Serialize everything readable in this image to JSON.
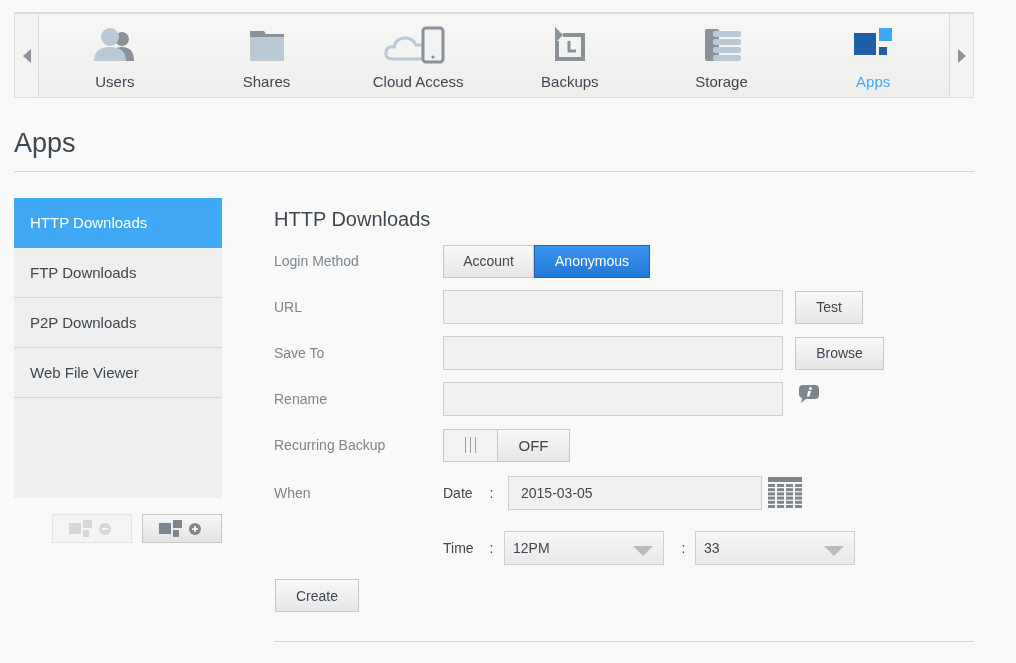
{
  "nav": {
    "items": [
      {
        "label": "Users",
        "selected": false
      },
      {
        "label": "Shares",
        "selected": false
      },
      {
        "label": "Cloud Access",
        "selected": false
      },
      {
        "label": "Backups",
        "selected": false
      },
      {
        "label": "Storage",
        "selected": false
      },
      {
        "label": "Apps",
        "selected": true
      }
    ]
  },
  "page_title": "Apps",
  "sidebar": {
    "items": [
      {
        "label": "HTTP Downloads",
        "selected": true
      },
      {
        "label": "FTP Downloads",
        "selected": false
      },
      {
        "label": "P2P Downloads",
        "selected": false
      },
      {
        "label": "Web File Viewer",
        "selected": false
      }
    ]
  },
  "sidebar_buttons": [
    {
      "kind": "remove",
      "disabled": true
    },
    {
      "kind": "add",
      "disabled": false
    }
  ],
  "form": {
    "title": "HTTP Downloads",
    "login_method": {
      "label": "Login Method",
      "options": [
        {
          "label": "Account",
          "selected": false
        },
        {
          "label": "Anonymous",
          "selected": true
        }
      ]
    },
    "url": {
      "label": "URL",
      "button": "Test"
    },
    "save_to": {
      "label": "Save To",
      "button": "Browse"
    },
    "rename": {
      "label": "Rename"
    },
    "recurring_backup": {
      "label": "Recurring Backup",
      "on": false,
      "state_text": "OFF"
    },
    "when": {
      "label": "When",
      "date_label": "Date",
      "date_colon": ":",
      "date": "2015-03-05",
      "time_label": "Time",
      "time_colon": ":",
      "hour": "12PM",
      "hour_colon": ":",
      "minute": "33"
    },
    "create": "Create"
  }
}
